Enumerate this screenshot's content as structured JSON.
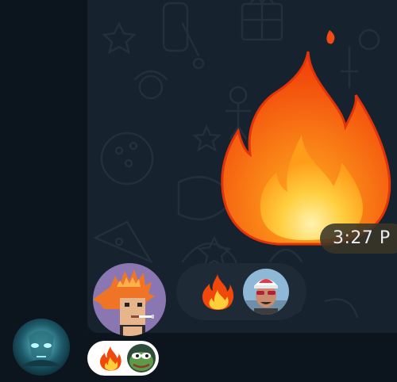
{
  "message": {
    "sticker": "fire-sticker",
    "time": "3:27 P"
  },
  "reactions": [
    {
      "emoji": "fire",
      "avatar": "user-avatar-glasses"
    }
  ],
  "own_reaction": [
    "fire",
    "pepe-frog"
  ],
  "colors": {
    "chat_background": "#16222d",
    "sidebar": "#0c151d",
    "reaction_pill": "#1e2b37",
    "timestamp_bubble": "#3a3428",
    "own_pill": "#ffffff"
  }
}
